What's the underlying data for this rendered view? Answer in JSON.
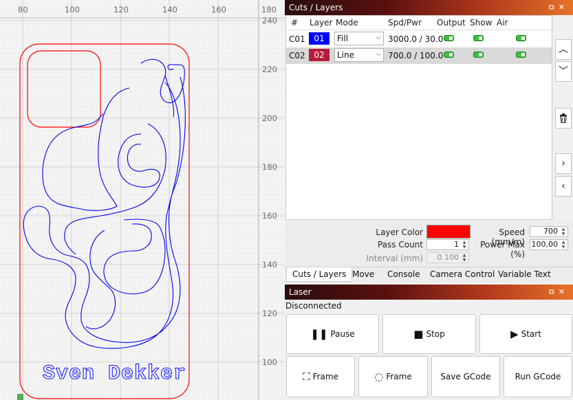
{
  "canvas": {
    "ruler_x_labels": [
      "80",
      "100",
      "120",
      "140",
      "160",
      "180"
    ],
    "ruler_y_labels": [
      "240",
      "220",
      "200",
      "180",
      "160",
      "140",
      "120",
      "100"
    ],
    "engraved_text": "Sven Dekker",
    "colors": {
      "fill_layer": "#0000ff",
      "cut_layer": "#ff0000"
    }
  },
  "cuts_panel": {
    "title": "Cuts / Layers",
    "columns": [
      "#",
      "Layer",
      "Mode",
      "Spd/Pwr",
      "Output",
      "Show",
      "Air"
    ],
    "rows": [
      {
        "id": "C01",
        "layer": "01",
        "layer_color": "#0000ff",
        "mode": "Fill",
        "spd_pwr": "3000.0 / 30.0",
        "output": true,
        "show": true,
        "air": true
      },
      {
        "id": "C02",
        "layer": "02",
        "layer_color": "#b81a3c",
        "mode": "Line",
        "spd_pwr": "700.0 / 100.0",
        "output": true,
        "show": true,
        "air": true,
        "selected": true
      }
    ],
    "side_icons": [
      "chevron-up-icon",
      "chevron-down-icon",
      "trash-icon",
      "chevron-right-icon",
      "chevron-left-icon"
    ],
    "props": {
      "layer_color_label": "Layer Color",
      "layer_color": "#ff0000",
      "pass_count_label": "Pass Count",
      "pass_count": "1",
      "interval_label": "Interval (mm)",
      "interval": "0.100",
      "speed_label": "Speed (mm/m)",
      "speed": "700",
      "power_max_label": "Power Max (%)",
      "power_max": "100,00"
    },
    "tabs": [
      "Cuts / Layers",
      "Move",
      "Console",
      "Camera Control",
      "Variable Text"
    ]
  },
  "laser_panel": {
    "title": "Laser",
    "status": "Disconnected",
    "buttons": {
      "pause": "Pause",
      "stop": "Stop",
      "start": "Start",
      "frame_rect": "Frame",
      "frame_circle": "Frame",
      "save_gcode": "Save GCode",
      "run_gcode": "Run GCode"
    }
  }
}
